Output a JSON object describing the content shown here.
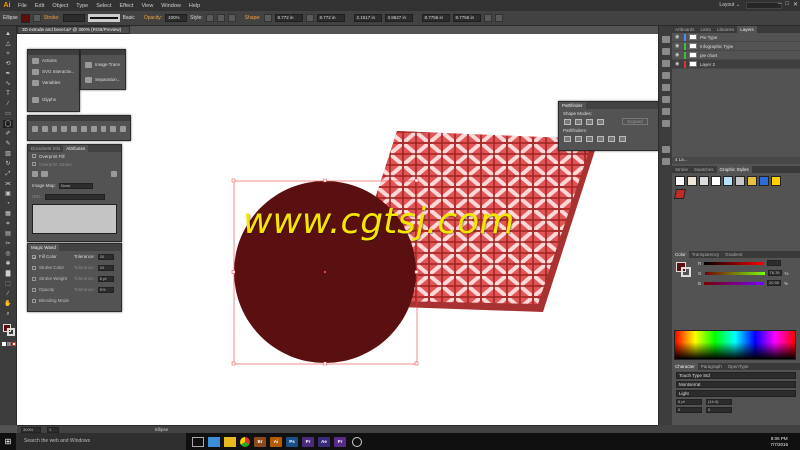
{
  "menubar": {
    "logo": "Ai",
    "items": [
      "File",
      "Edit",
      "Object",
      "Type",
      "Select",
      "Effect",
      "View",
      "Window",
      "Help"
    ],
    "workspace": "Layout ⌄",
    "win_controls": [
      "–",
      "□",
      "✕"
    ]
  },
  "controlbar": {
    "object_type": "Ellipse",
    "stroke_label": "Stroke:",
    "stroke_profile": "Basic",
    "opacity_label": "Opacity:",
    "opacity_value": "100%",
    "style_label": "Style:",
    "shape_label": "Shape:",
    "w_value": "8.772 in",
    "h_value": "8.772 in",
    "x_value": "2.1517 in",
    "y_value": "3.9627 in",
    "w2_value": "8.7756 in",
    "h2_value": "8.7756 in",
    "fill_color": "#5a1010"
  },
  "document": {
    "tab_title": "3D extrude and bevel.ai* @ 300% (RGB/Preview)"
  },
  "panels": {
    "actions": {
      "items": [
        {
          "icon": "play-icon",
          "label": "Actions"
        },
        {
          "icon": "svg-icon",
          "label": "SVG Interactiv..."
        },
        {
          "icon": "variables-icon",
          "label": "Variables"
        },
        {
          "icon": "glyphs-icon",
          "label": "Glyphs"
        }
      ]
    },
    "trace": {
      "items": [
        {
          "icon": "image-trace-icon",
          "label": "Image Trace"
        },
        {
          "icon": "separations-icon",
          "label": "Separation..."
        }
      ]
    },
    "attributes": {
      "tabs": [
        "Document Info",
        "Attributes"
      ],
      "overprint_fill": "Overprint Fill",
      "overprint_stroke": "Overprint Stroke",
      "image_map_label": "Image Map:",
      "image_map_value": "None",
      "url_label": "URL:"
    },
    "magic_wand": {
      "title": "Magic Wand",
      "rows": [
        {
          "label": "Fill Color",
          "checked": true,
          "tol_label": "Tolerance:",
          "tol": "20"
        },
        {
          "label": "Stroke Color",
          "checked": false,
          "tol_label": "Tolerance:",
          "tol": "20"
        },
        {
          "label": "Stroke Weight",
          "checked": false,
          "tol_label": "Tolerance:",
          "tol": "5 pt"
        },
        {
          "label": "Opacity",
          "checked": false,
          "tol_label": "Tolerance:",
          "tol": "5%"
        },
        {
          "label": "Blending Mode",
          "checked": false,
          "tol_label": "",
          "tol": ""
        }
      ]
    },
    "pathfinder": {
      "title": "Pathfinder",
      "shape_modes": "Shape Modes:",
      "pathfinders": "Pathfinders:",
      "expand": "Expand"
    }
  },
  "dock": {
    "top_tabs": [
      "Artboards",
      "Links",
      "Libraries",
      "Layers"
    ],
    "layers": [
      {
        "name": "Pie Type",
        "color": "#4f8cff"
      },
      {
        "name": "Infographic Type",
        "color": "#39c13a"
      },
      {
        "name": "pie chart",
        "color": "#39c13a"
      },
      {
        "name": "Layer 2",
        "color": "#d33"
      }
    ],
    "layers_footer": "4 La...",
    "style_tabs": [
      "Stroke",
      "Swatches",
      "Graphic Styles"
    ],
    "graphic_styles": [
      "#ffffff",
      "#f0e6d8",
      "#dcdcdc",
      "#ffffff",
      "#b8e0f8",
      "#c8c8c8",
      "#e8c040",
      "#2a6cd8",
      "#ffd000"
    ],
    "selected_style": "#c02a2a",
    "color_tabs": [
      "Color",
      "Transparency",
      "Gradient"
    ],
    "color": {
      "r_label": "R",
      "r_value": "",
      "g_label": "G",
      "g_value": "76.76",
      "b_label": "B",
      "b_value": "20.95",
      "pct": "%"
    },
    "char_tabs": [
      "Character",
      "Paragraph",
      "OpenType"
    ],
    "font_search": "Touch Type Std",
    "font_name": "Montserrat",
    "font_style": "Light",
    "font_size": "6 pt",
    "leading": "(14.4)",
    "tracking": "0",
    "kerning": "0"
  },
  "statusbar": {
    "zoom": "300%",
    "artboard": "1",
    "selection": "Ellipse"
  },
  "taskbar": {
    "search": "Search the web and Windows",
    "apps": [
      {
        "label": "Br",
        "color": "#8a4a1a"
      },
      {
        "label": "Ai",
        "color": "#b35b00"
      },
      {
        "label": "Ps",
        "color": "#1b4f8a"
      },
      {
        "label": "Pr",
        "color": "#4a2a7a"
      },
      {
        "label": "Ae",
        "color": "#3a2a7a"
      },
      {
        "label": "Pr",
        "color": "#5a2a8a"
      }
    ],
    "time": "8:06 PM",
    "date": "7/7/2016"
  },
  "artwork": {
    "circle_color": "#5a1010",
    "lattice_color": "#e05555",
    "lattice_dark": "#b03030",
    "selection_color": "#e84040"
  },
  "watermark": "www.cgtsj.com"
}
